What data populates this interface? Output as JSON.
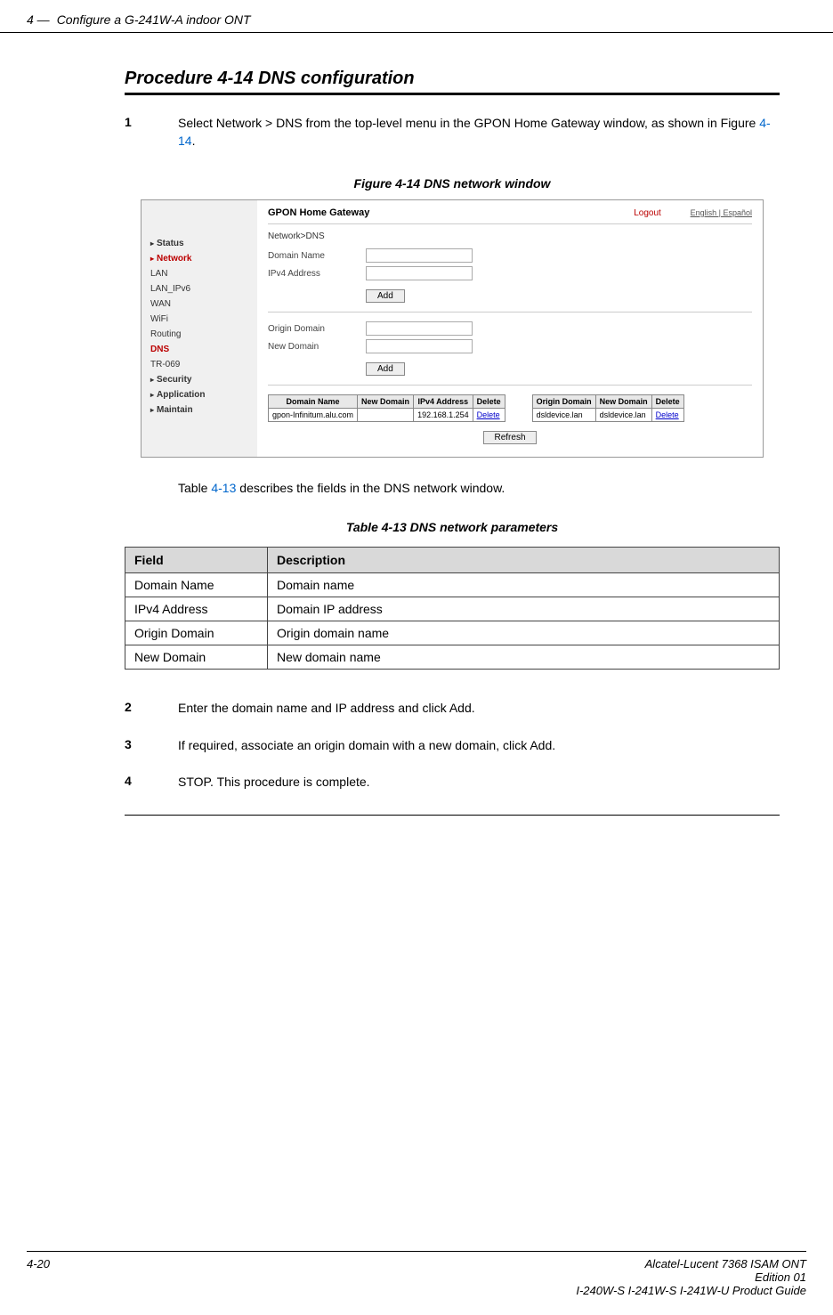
{
  "header": {
    "chapter_num": "4 —",
    "chapter_title": "Configure a G-241W-A indoor ONT"
  },
  "procedure": {
    "heading": "Procedure 4-14  DNS configuration",
    "step1_num": "1",
    "step1_text_a": "Select Network > DNS from the top-level menu in the GPON Home Gateway window, as shown in Figure ",
    "step1_link": "4-14",
    "step1_text_b": "."
  },
  "figure": {
    "caption": "Figure 4-14  DNS network window"
  },
  "screenshot": {
    "title": "GPON Home Gateway",
    "logout": "Logout",
    "lang": "English | Español",
    "breadcrumb": "Network>DNS",
    "labels": {
      "domain_name": "Domain Name",
      "ipv4_address": "IPv4 Address",
      "origin_domain": "Origin Domain",
      "new_domain": "New Domain"
    },
    "buttons": {
      "add": "Add",
      "refresh": "Refresh",
      "delete": "Delete"
    },
    "nav": {
      "status": "Status",
      "network": "Network",
      "lan": "LAN",
      "lan_ipv6": "LAN_IPv6",
      "wan": "WAN",
      "wifi": "WiFi",
      "routing": "Routing",
      "dns": "DNS",
      "tr069": "TR-069",
      "security": "Security",
      "application": "Application",
      "maintain": "Maintain"
    },
    "table1": {
      "h1": "Domain Name",
      "h2": "New Domain",
      "h3": "IPv4 Address",
      "h4": "Delete",
      "r1c1": "gpon-Infinitum.alu.com",
      "r1c2": "",
      "r1c3": "192.168.1.254"
    },
    "table2": {
      "h1": "Origin Domain",
      "h2": "New Domain",
      "h3": "Delete",
      "r1c1": "dsldevice.lan",
      "r1c2": "dsldevice.lan"
    }
  },
  "table_intro_a": "Table ",
  "table_intro_link": "4-13",
  "table_intro_b": " describes the fields in the DNS network window.",
  "params_table": {
    "caption": "Table 4-13 DNS network parameters",
    "h_field": "Field",
    "h_desc": "Description",
    "rows": [
      {
        "field": "Domain Name",
        "desc": "Domain name"
      },
      {
        "field": "IPv4 Address",
        "desc": "Domain IP address"
      },
      {
        "field": "Origin Domain",
        "desc": "Origin domain name"
      },
      {
        "field": "New Domain",
        "desc": "New domain name"
      }
    ]
  },
  "steps_after": {
    "s2_num": "2",
    "s2_text": "Enter the domain name and IP address and click Add.",
    "s3_num": "3",
    "s3_text": "If required, associate an origin domain with a new domain, click Add.",
    "s4_num": "4",
    "s4_text": "STOP. This procedure is complete."
  },
  "footer": {
    "page_num": "4-20",
    "line1": "Alcatel-Lucent 7368 ISAM ONT",
    "line2": "Edition 01",
    "line3": "I-240W-S I-241W-S I-241W-U Product Guide"
  }
}
